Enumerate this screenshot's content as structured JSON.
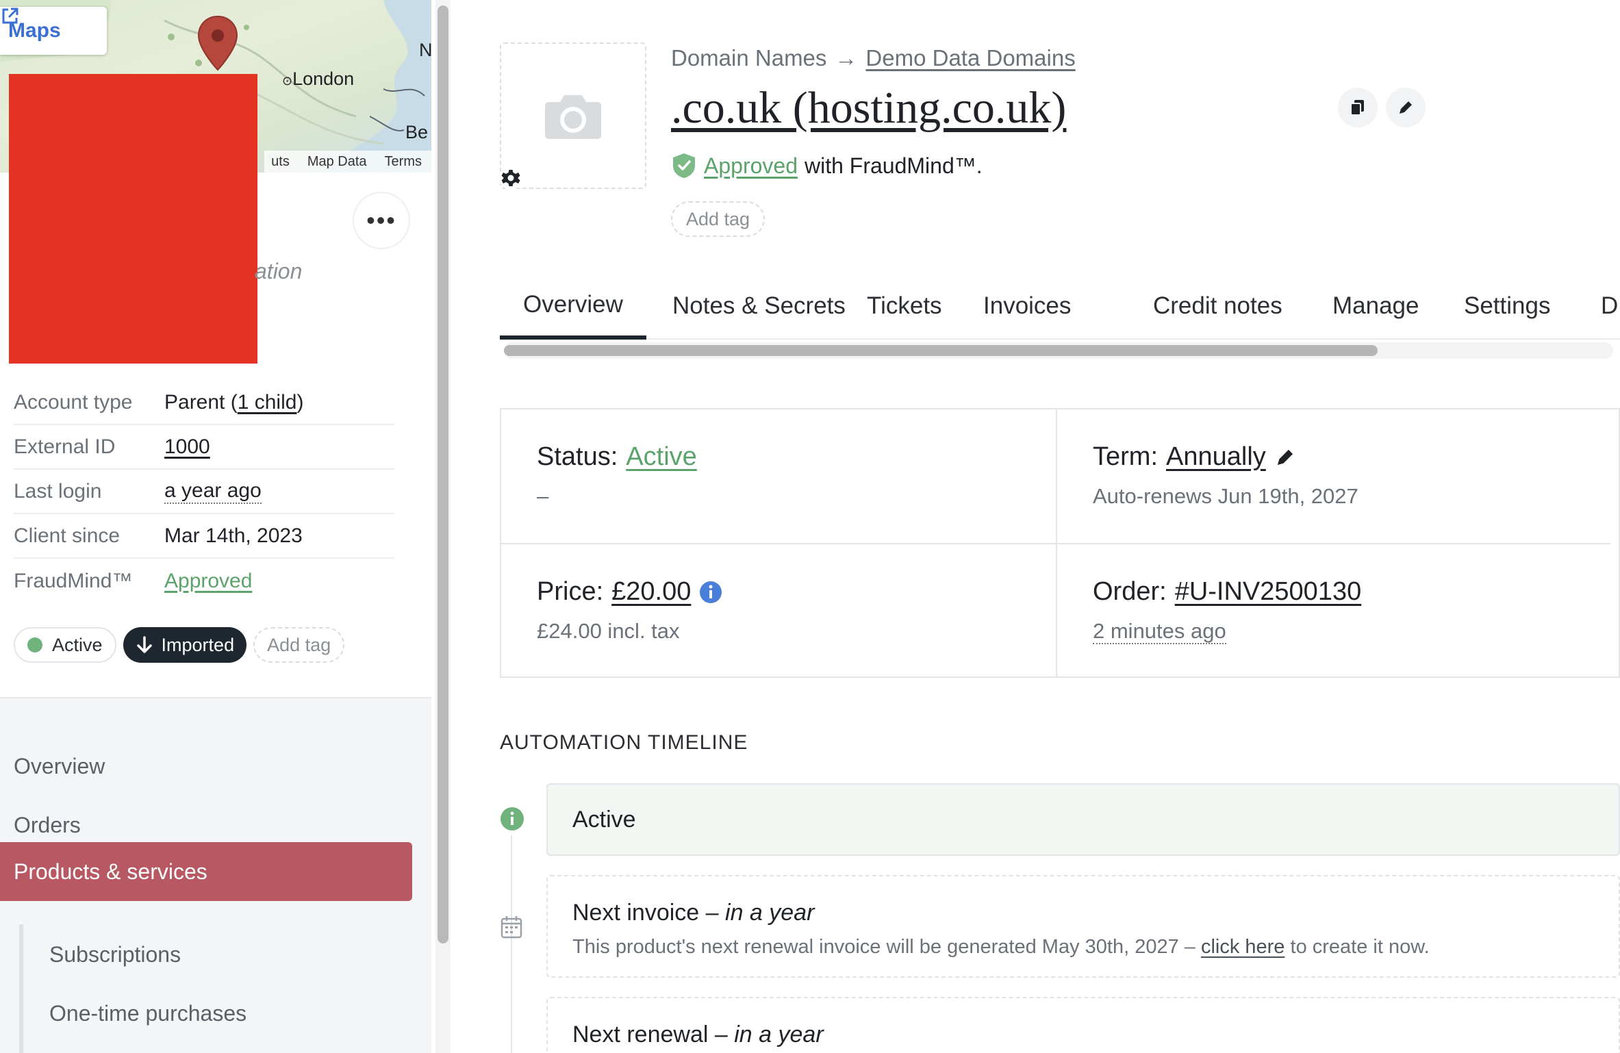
{
  "map": {
    "chip_label": "Maps",
    "place_labels": [
      "London",
      "Be",
      "N"
    ],
    "footer": [
      "uts",
      "Map Data",
      "Terms"
    ]
  },
  "sidebar": {
    "ghost_text": "ation",
    "info": [
      {
        "key": "Account type",
        "value_prefix": "Parent (",
        "value_link": "1 child",
        "value_suffix": ")"
      },
      {
        "key": "External ID",
        "value": "1000"
      },
      {
        "key": "Last login",
        "value": "a year ago"
      },
      {
        "key": "Client since",
        "value": "Mar 14th, 2023"
      },
      {
        "key": "FraudMind™",
        "value": "Approved"
      }
    ],
    "tags": {
      "active": "Active",
      "imported": "Imported",
      "add_tag": "Add tag"
    },
    "nav": {
      "overview": "Overview",
      "orders": "Orders",
      "products": "Products & services",
      "subscriptions": "Subscriptions",
      "one_time": "One-time purchases"
    }
  },
  "header": {
    "breadcrumb_parent": "Domain Names",
    "breadcrumb_arrow": "→",
    "breadcrumb_current": "Demo Data Domains",
    "title": ".co.uk (hosting.co.uk)",
    "approved_link": "Approved",
    "approved_suffix": "with FraudMind™.",
    "add_tag": "Add tag"
  },
  "tabs": [
    "Overview",
    "Notes & Secrets",
    "Tickets",
    "Invoices",
    "Credit notes",
    "Manage",
    "Settings",
    "D"
  ],
  "summary": {
    "status_label": "Status:",
    "status_value": "Active",
    "status_sub": "–",
    "term_label": "Term:",
    "term_value": "Annually",
    "term_sub": "Auto-renews Jun 19th, 2027",
    "price_label": "Price:",
    "price_value": "£20.00",
    "price_sub": "£24.00 incl. tax",
    "order_label": "Order:",
    "order_value": "#U-INV2500130",
    "order_sub": "2 minutes ago"
  },
  "timeline": {
    "title": "AUTOMATION TIMELINE",
    "active_label": "Active",
    "next_invoice_title": "Next invoice",
    "next_invoice_when": "– in a year",
    "next_invoice_desc_pre": "This product's next renewal invoice will be generated May 30th, 2027 –",
    "next_invoice_link": "click here",
    "next_invoice_desc_post": "to create it now.",
    "next_renewal_title": "Next renewal",
    "next_renewal_when": "– in a year"
  },
  "colors": {
    "accent_nav": "#b85862",
    "green": "#5aa36a",
    "dark_pill": "#1e2730",
    "info_blue": "#4a7fd9"
  }
}
